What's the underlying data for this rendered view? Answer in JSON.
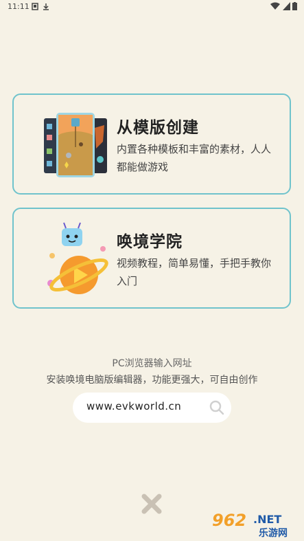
{
  "status_bar": {
    "time": "11:11"
  },
  "cards": [
    {
      "title": "从模版创建",
      "desc": "内置各种模板和丰富的素材，人人都能做游戏"
    },
    {
      "title": "唤境学院",
      "desc": "视频教程，简单易懂，手把手教你入门"
    }
  ],
  "pc_hint": {
    "line1": "PC浏览器输入网址",
    "line2": "安装唤境电脑版编辑器，功能更强大，可自由创作",
    "url": "www.evkworld.cn"
  },
  "watermark": {
    "number": "962",
    "suffix": ".NET",
    "name": "乐游网"
  },
  "icons": {
    "template": "template-cards-icon",
    "academy": "academy-planet-icon",
    "search": "search-icon",
    "close": "close-icon"
  },
  "colors": {
    "background": "#f6f2e6",
    "card_border": "#6fc3cc",
    "close": "#c9c1b4"
  }
}
